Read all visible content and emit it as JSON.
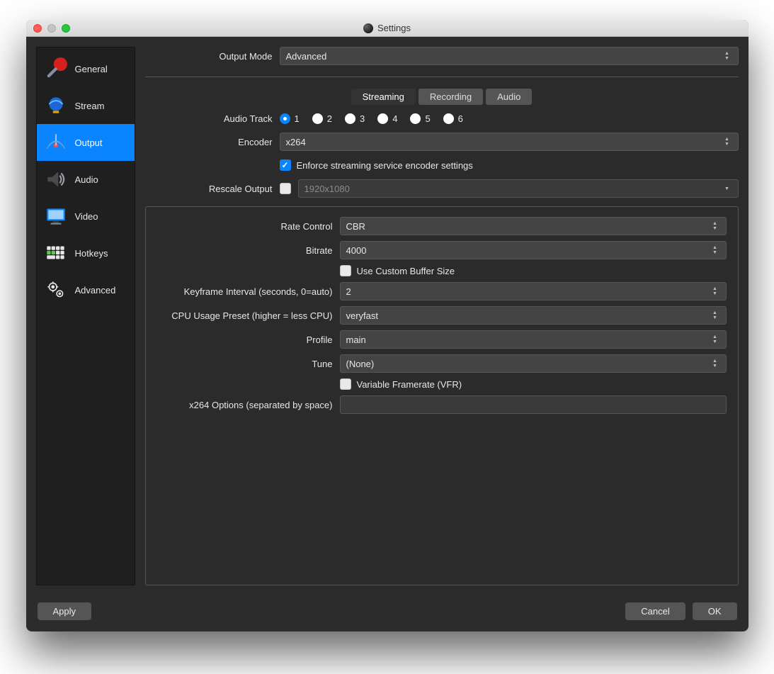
{
  "window": {
    "title": "Settings"
  },
  "sidebar": {
    "items": [
      {
        "label": "General"
      },
      {
        "label": "Stream"
      },
      {
        "label": "Output"
      },
      {
        "label": "Audio"
      },
      {
        "label": "Video"
      },
      {
        "label": "Hotkeys"
      },
      {
        "label": "Advanced"
      }
    ],
    "active_index": 2
  },
  "output_mode": {
    "label": "Output Mode",
    "value": "Advanced"
  },
  "tabs": {
    "items": [
      {
        "label": "Streaming"
      },
      {
        "label": "Recording"
      },
      {
        "label": "Audio"
      }
    ],
    "active_index": 0
  },
  "streaming": {
    "audio_track": {
      "label": "Audio Track",
      "options": [
        "1",
        "2",
        "3",
        "4",
        "5",
        "6"
      ],
      "selected": "1"
    },
    "encoder": {
      "label": "Encoder",
      "value": "x264"
    },
    "enforce": {
      "label": "Enforce streaming service encoder settings",
      "checked": true
    },
    "rescale": {
      "label": "Rescale Output",
      "checked": false,
      "value": "1920x1080"
    }
  },
  "encoder_settings": {
    "rate_control": {
      "label": "Rate Control",
      "value": "CBR"
    },
    "bitrate": {
      "label": "Bitrate",
      "value": "4000"
    },
    "custom_buffer": {
      "label": "Use Custom Buffer Size",
      "checked": false
    },
    "keyframe": {
      "label": "Keyframe Interval (seconds, 0=auto)",
      "value": "2"
    },
    "cpu_preset": {
      "label": "CPU Usage Preset (higher = less CPU)",
      "value": "veryfast"
    },
    "profile": {
      "label": "Profile",
      "value": "main"
    },
    "tune": {
      "label": "Tune",
      "value": "(None)"
    },
    "vfr": {
      "label": "Variable Framerate (VFR)",
      "checked": false
    },
    "x264opts": {
      "label": "x264 Options (separated by space)",
      "value": ""
    }
  },
  "footer": {
    "apply": "Apply",
    "cancel": "Cancel",
    "ok": "OK"
  }
}
